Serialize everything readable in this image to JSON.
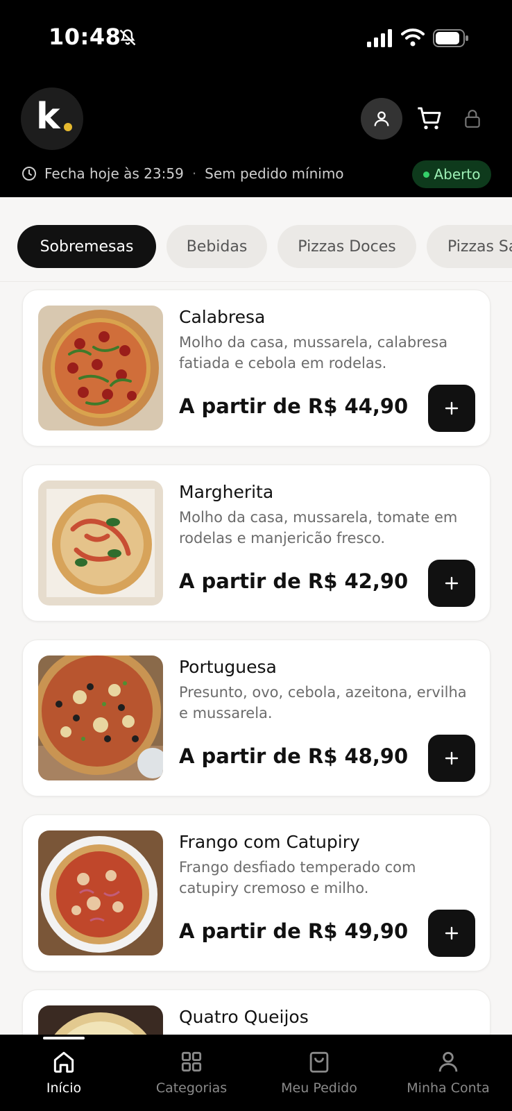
{
  "status_bar": {
    "time": "10:48"
  },
  "brand": {
    "logo_text": "k",
    "dot_color": "#e5b92f"
  },
  "store_info": {
    "hours": "Fecha hoje às 23:59",
    "separator": "·",
    "minimum": "Sem pedido mínimo",
    "status": "Aberto",
    "status_color": "#35d06a"
  },
  "categories": [
    {
      "label": "Sobremesas",
      "active": true
    },
    {
      "label": "Bebidas",
      "active": false
    },
    {
      "label": "Pizzas Doces",
      "active": false
    },
    {
      "label": "Pizzas Salgadas",
      "active": false
    }
  ],
  "products": [
    {
      "name": "Calabresa",
      "description": "Molho da casa, mussarela, calabresa fatiada e cebola em rodelas.",
      "price": "A partir de R$ 44,90",
      "icon": "pizza-calabresa"
    },
    {
      "name": "Margherita",
      "description": "Molho da casa, mussarela, tomate em rodelas e manjericão fresco.",
      "price": "A partir de R$ 42,90",
      "icon": "pizza-margherita"
    },
    {
      "name": "Portuguesa",
      "description": "Presunto, ovo, cebola, azeitona, ervilha e mussarela.",
      "price": "A partir de R$ 48,90",
      "icon": "pizza-portuguesa"
    },
    {
      "name": "Frango com Catupiry",
      "description": "Frango desfiado temperado com catupiry cremoso e milho.",
      "price": "A partir de R$ 49,90",
      "icon": "pizza-frango"
    },
    {
      "name": "Quatro Queijos",
      "description": "",
      "price": "",
      "icon": "pizza-quatro-queijos"
    }
  ],
  "bottom_nav": [
    {
      "label": "Início",
      "icon": "home-icon",
      "active": true
    },
    {
      "label": "Categorias",
      "icon": "grid-icon",
      "active": false
    },
    {
      "label": "Meu Pedido",
      "icon": "bag-icon",
      "active": false
    },
    {
      "label": "Minha Conta",
      "icon": "user-icon",
      "active": false
    }
  ]
}
